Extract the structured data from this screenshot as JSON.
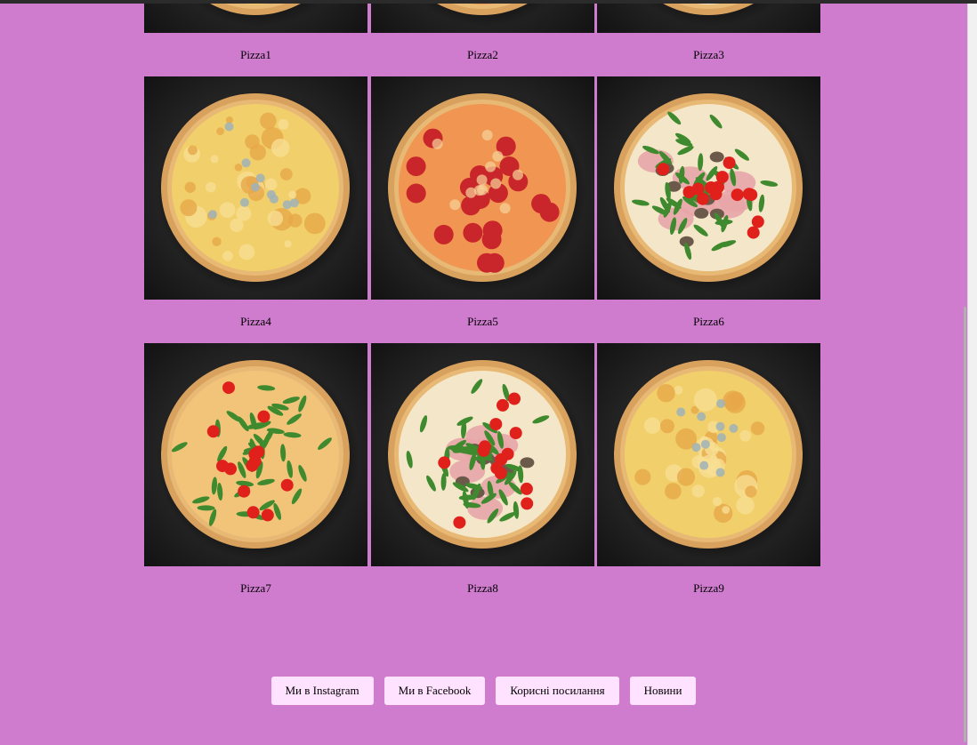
{
  "pizzas": [
    {
      "name": "Pizza1",
      "style": "cheese"
    },
    {
      "name": "Pizza2",
      "style": "pepperoni"
    },
    {
      "name": "Pizza3",
      "style": "ham-arugula"
    },
    {
      "name": "Pizza4",
      "style": "cheese"
    },
    {
      "name": "Pizza5",
      "style": "pepperoni"
    },
    {
      "name": "Pizza6",
      "style": "ham-arugula"
    },
    {
      "name": "Pizza7",
      "style": "arugula-tomato"
    },
    {
      "name": "Pizza8",
      "style": "ham-arugula"
    },
    {
      "name": "Pizza9",
      "style": "cheese"
    }
  ],
  "footer": {
    "links": [
      {
        "label": "Ми в Instagram"
      },
      {
        "label": "Ми в Facebook"
      },
      {
        "label": "Корисні посилання"
      },
      {
        "label": "Новини"
      }
    ]
  },
  "colors": {
    "page_background": "#cf7ccf",
    "button_background": "#ffe2ff",
    "image_background": "#262626"
  }
}
